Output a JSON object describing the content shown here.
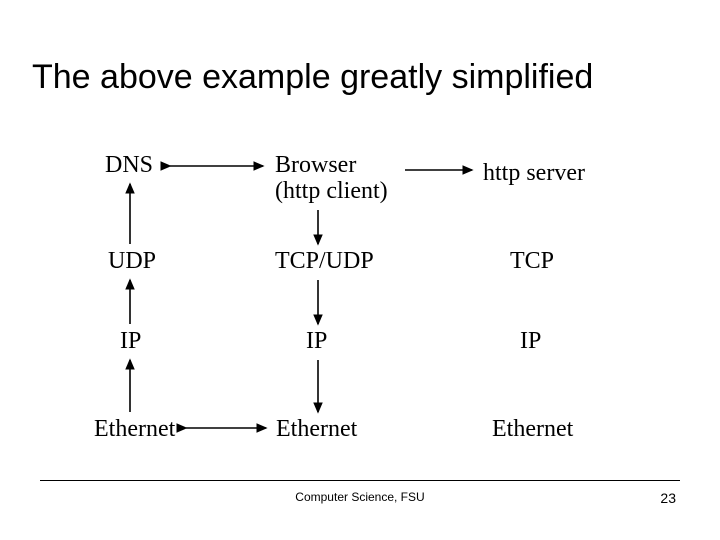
{
  "title": "The above example greatly simplified",
  "col1": {
    "dns": "DNS",
    "udp": "UDP",
    "ip": "IP",
    "eth": "Ethernet"
  },
  "col2": {
    "browser_l1": "Browser",
    "browser_l2": "(http client)",
    "tcpudp": "TCP/UDP",
    "ip": "IP",
    "eth": "Ethernet"
  },
  "col3": {
    "server": "http server",
    "tcp": "TCP",
    "ip": "IP",
    "eth": "Ethernet"
  },
  "footer": {
    "center": "Computer Science, FSU",
    "page": "23"
  }
}
